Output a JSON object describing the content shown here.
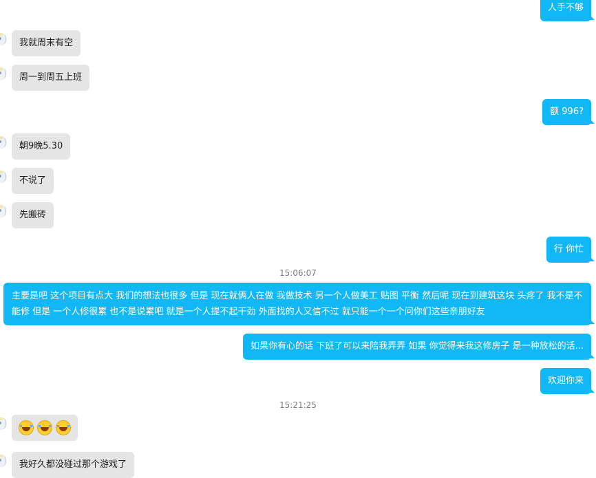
{
  "messages": [
    {
      "text": "人手不够"
    },
    {
      "text": "我就周末有空"
    },
    {
      "text": "周一到周五上班"
    },
    {
      "text": "额  996?"
    },
    {
      "text": "朝9晚5.30"
    },
    {
      "text": "不说了"
    },
    {
      "text": "先搬砖"
    },
    {
      "text": "行 你忙"
    },
    {
      "text": "主要是吧 这个项目有点大  我们的想法也很多  但是 现在就俩人在做 我做技术 另一个人做美工 贴图 平衡  然后呢 现在到建筑这块 头疼了  我不是不能修 但是 一个人修很累 也不是说累吧 就是一个人提不起干劲  外面找的人又信不过 就只能一个一个问你们这些亲朋好友"
    },
    {
      "text": "如果你有心的话  下班了可以来陪我弄弄 如果 你觉得来我这修房子 是一种放松的话..."
    },
    {
      "text": "欢迎你来"
    },
    {
      "text": "😂😂😂",
      "emoji_names": [
        "laughing-crying-emoji",
        "laughing-crying-emoji",
        "laughing-crying-emoji"
      ]
    },
    {
      "text": "我好久都没碰过那个游戏了"
    }
  ],
  "timestamps": [
    "15:06:07",
    "15:21:25"
  ],
  "colors": {
    "sent_bubble": "#12b7f5",
    "received_bubble": "#e5e5e5"
  }
}
